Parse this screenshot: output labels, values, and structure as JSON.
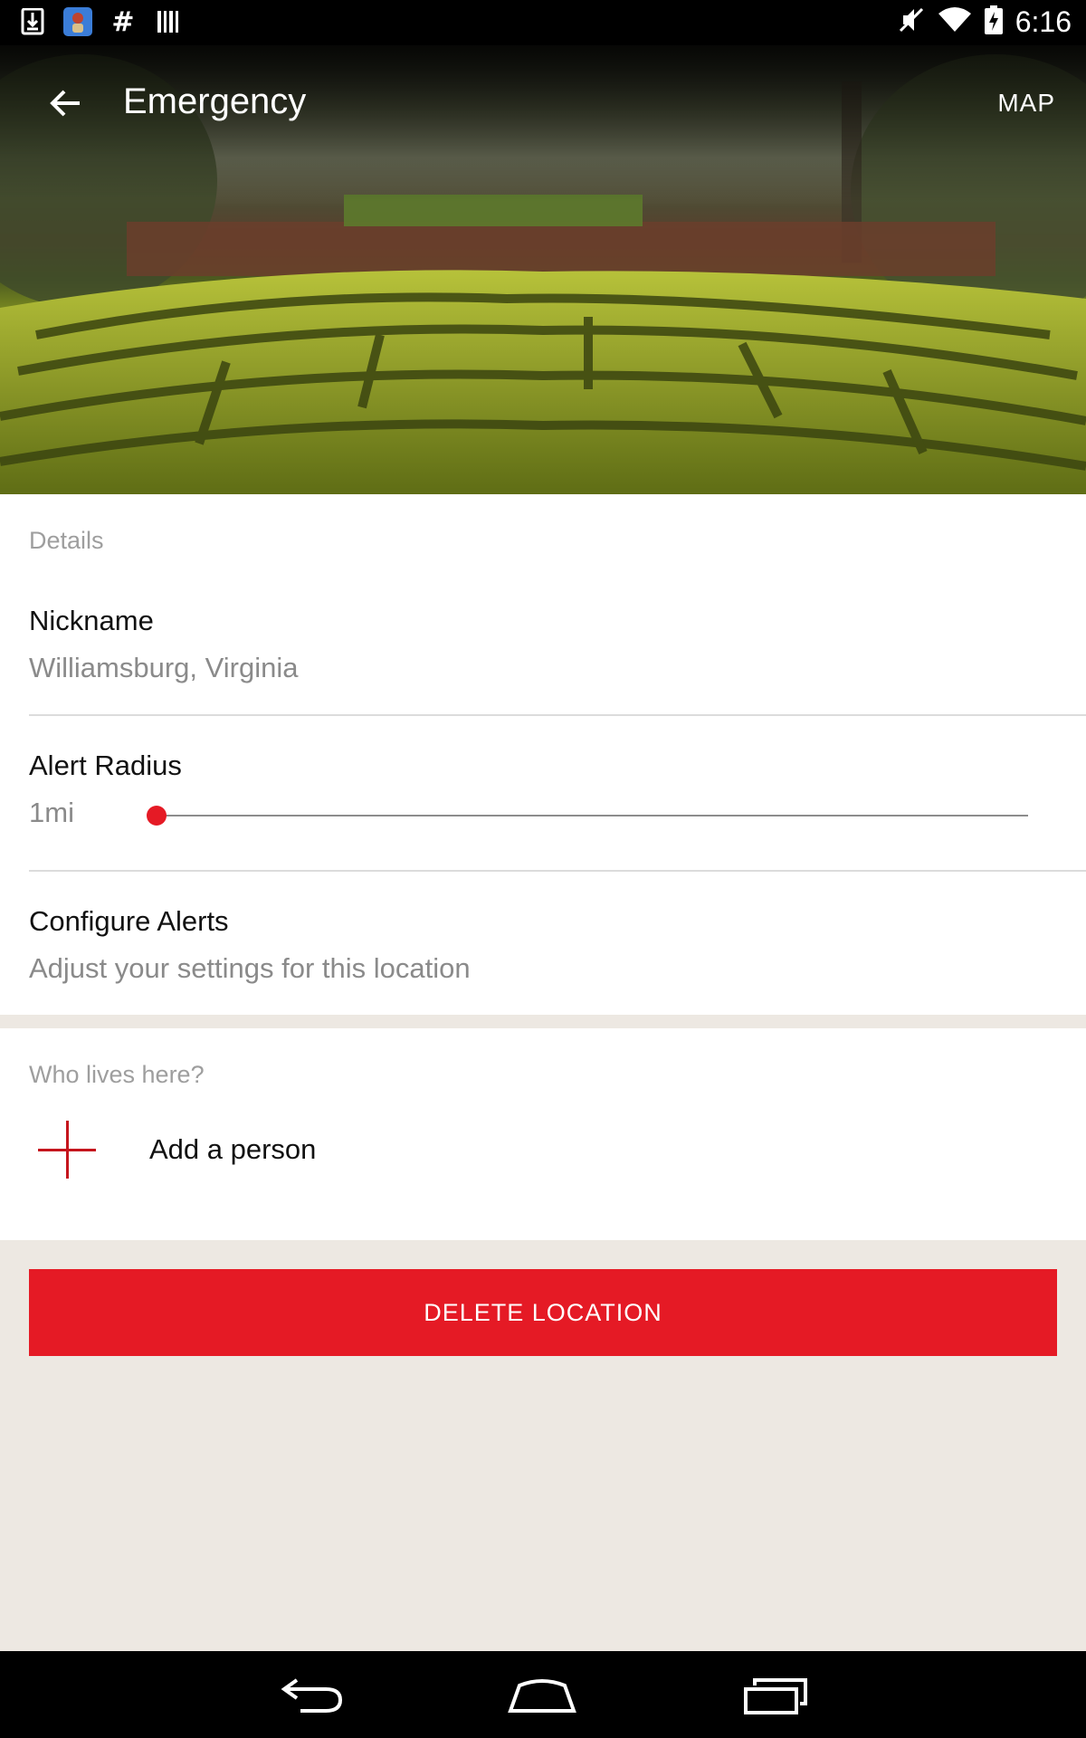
{
  "status_bar": {
    "time": "6:16",
    "left_icons": [
      "download-icon",
      "app-notification-icon",
      "hashtag-icon",
      "barcode-icon"
    ],
    "right_icons": [
      "mute-icon",
      "wifi-icon",
      "battery-charging-icon"
    ]
  },
  "app_bar": {
    "title": "Emergency",
    "map_label": "MAP"
  },
  "details": {
    "section_label": "Details",
    "nickname_label": "Nickname",
    "nickname_value": "Williamsburg, Virginia",
    "alert_radius_label": "Alert Radius",
    "alert_radius_value": "1mi",
    "alert_radius_slider_fraction": 0.0,
    "configure_alerts_label": "Configure Alerts",
    "configure_alerts_sub": "Adjust your settings for this location"
  },
  "people": {
    "section_label": "Who lives here?",
    "add_person_label": "Add a person"
  },
  "actions": {
    "delete_label": "DELETE LOCATION"
  },
  "colors": {
    "accent": "#e51a25",
    "plus_icon": "#c5151d",
    "background": "#ede8e2"
  },
  "nav_bar": {
    "icons": [
      "back-nav-icon",
      "home-nav-icon",
      "recents-nav-icon"
    ]
  }
}
